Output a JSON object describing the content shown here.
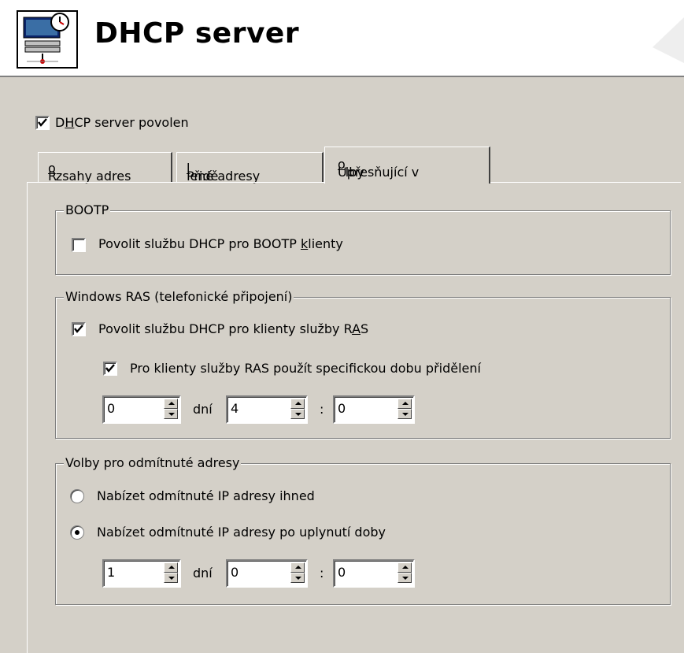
{
  "header": {
    "title": "DHCP server",
    "icon": "dhcp-server-icon"
  },
  "enable_checkbox": {
    "pre": "D",
    "accel": "H",
    "post": "CP server povolen",
    "checked": true
  },
  "tabs": [
    {
      "pre": "R",
      "accel": "o",
      "post": "zsahy adres",
      "active": false
    },
    {
      "pre": "Přidě",
      "accel": "l",
      "post": "ené adresy",
      "active": false
    },
    {
      "pre": "Upřesňující v",
      "accel": "o",
      "post": "lby",
      "active": true
    }
  ],
  "bootp": {
    "title": "BOOTP",
    "checkbox": {
      "pre": "Povolit službu DHCP pro BOOTP ",
      "accel": "k",
      "post": "lienty",
      "checked": false
    }
  },
  "ras": {
    "title": "Windows RAS (telefonické připojení)",
    "enable": {
      "pre": "Povolit službu DHCP pro klienty služby R",
      "accel": "A",
      "post": "S",
      "checked": true
    },
    "specific_lease": {
      "label": "Pro klienty služby RAS použít specifickou dobu přidělení",
      "checked": true
    },
    "days": "0",
    "days_label": "dní",
    "hours": "4",
    "separator": ":",
    "minutes": "0"
  },
  "declined": {
    "title": "Volby pro odmítnuté adresy",
    "option1": {
      "label": "Nabízet odmítnuté IP adresy ihned",
      "selected": false
    },
    "option2": {
      "label": "Nabízet odmítnuté IP adresy po uplynutí doby",
      "selected": true
    },
    "days": "1",
    "days_label": "dní",
    "hours": "0",
    "separator": ":",
    "minutes": "0"
  }
}
